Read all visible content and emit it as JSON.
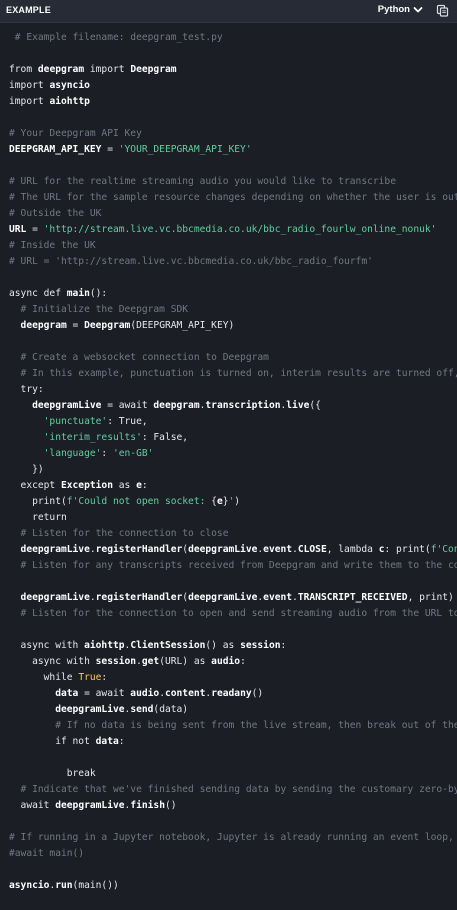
{
  "header": {
    "label": "EXAMPLE",
    "language": "Python"
  },
  "code": {
    "lines": [
      [
        {
          "t": " # Example filename: deepgram_test.py",
          "k": "c"
        }
      ],
      [],
      [
        {
          "t": "from ",
          "k": "n"
        },
        {
          "t": "deepgram",
          "k": "b"
        },
        {
          "t": " import ",
          "k": "n"
        },
        {
          "t": "Deepgram",
          "k": "b"
        }
      ],
      [
        {
          "t": "import ",
          "k": "n"
        },
        {
          "t": "asyncio",
          "k": "b"
        }
      ],
      [
        {
          "t": "import ",
          "k": "n"
        },
        {
          "t": "aiohttp",
          "k": "b"
        }
      ],
      [],
      [
        {
          "t": "# Your Deepgram API Key",
          "k": "c"
        }
      ],
      [
        {
          "t": "DEEPGRAM_API_KEY",
          "k": "b"
        },
        {
          "t": " = ",
          "k": "n"
        },
        {
          "t": "'YOUR_DEEPGRAM_API_KEY'",
          "k": "s"
        }
      ],
      [],
      [
        {
          "t": "# URL for the realtime streaming audio you would like to transcribe",
          "k": "c"
        }
      ],
      [
        {
          "t": "# The URL for the sample resource changes depending on whether the user is outsi",
          "k": "c"
        }
      ],
      [
        {
          "t": "# Outside the UK",
          "k": "c"
        }
      ],
      [
        {
          "t": "URL",
          "k": "b"
        },
        {
          "t": " = ",
          "k": "n"
        },
        {
          "t": "'http://stream.live.vc.bbcmedia.co.uk/bbc_radio_fourlw_online_nonuk'",
          "k": "s"
        }
      ],
      [
        {
          "t": "# Inside the UK",
          "k": "c"
        }
      ],
      [
        {
          "t": "# URL = 'http://stream.live.vc.bbcmedia.co.uk/bbc_radio_fourfm'",
          "k": "c"
        }
      ],
      [],
      [
        {
          "t": "async def ",
          "k": "n"
        },
        {
          "t": "main",
          "k": "b"
        },
        {
          "t": "():",
          "k": "n"
        }
      ],
      [
        {
          "t": "  # Initialize the Deepgram SDK",
          "k": "c"
        }
      ],
      [
        {
          "t": "  deepgram",
          "k": "b"
        },
        {
          "t": " = ",
          "k": "n"
        },
        {
          "t": "Deepgram",
          "k": "b"
        },
        {
          "t": "(DEEPGRAM_API_KEY)",
          "k": "n"
        }
      ],
      [],
      [
        {
          "t": "  # Create a websocket connection to Deepgram",
          "k": "c"
        }
      ],
      [
        {
          "t": "  # In this example, punctuation is turned on, interim results are turned off, a",
          "k": "c"
        }
      ],
      [
        {
          "t": "  try:",
          "k": "n"
        }
      ],
      [
        {
          "t": "    deepgramLive",
          "k": "b"
        },
        {
          "t": " = await ",
          "k": "n"
        },
        {
          "t": "deepgram",
          "k": "b"
        },
        {
          "t": ".",
          "k": "n"
        },
        {
          "t": "transcription",
          "k": "b"
        },
        {
          "t": ".",
          "k": "n"
        },
        {
          "t": "live",
          "k": "b"
        },
        {
          "t": "({",
          "k": "n"
        }
      ],
      [
        {
          "t": "      ",
          "k": "n"
        },
        {
          "t": "'punctuate'",
          "k": "s"
        },
        {
          "t": ": True,",
          "k": "n"
        }
      ],
      [
        {
          "t": "      ",
          "k": "n"
        },
        {
          "t": "'interim_results'",
          "k": "s"
        },
        {
          "t": ": False,",
          "k": "n"
        }
      ],
      [
        {
          "t": "      ",
          "k": "n"
        },
        {
          "t": "'language'",
          "k": "s"
        },
        {
          "t": ": ",
          "k": "n"
        },
        {
          "t": "'en-GB'",
          "k": "s"
        }
      ],
      [
        {
          "t": "    })",
          "k": "n"
        }
      ],
      [
        {
          "t": "  except ",
          "k": "n"
        },
        {
          "t": "Exception",
          "k": "b"
        },
        {
          "t": " as ",
          "k": "n"
        },
        {
          "t": "e",
          "k": "b"
        },
        {
          "t": ":",
          "k": "n"
        }
      ],
      [
        {
          "t": "    print(",
          "k": "n"
        },
        {
          "t": "f'Could not open socket: ",
          "k": "s"
        },
        {
          "t": "{",
          "k": "n"
        },
        {
          "t": "e",
          "k": "b"
        },
        {
          "t": "}",
          "k": "n"
        },
        {
          "t": "'",
          "k": "s"
        },
        {
          "t": ")",
          "k": "n"
        }
      ],
      [
        {
          "t": "    return",
          "k": "n"
        }
      ],
      [],
      [
        {
          "t": "  # Listen for the connection to close",
          "k": "c"
        }
      ],
      [
        {
          "t": "  deepgramLive",
          "k": "b"
        },
        {
          "t": ".",
          "k": "n"
        },
        {
          "t": "registerHandler",
          "k": "b"
        },
        {
          "t": "(",
          "k": "n"
        },
        {
          "t": "deepgramLive",
          "k": "b"
        },
        {
          "t": ".",
          "k": "n"
        },
        {
          "t": "event",
          "k": "b"
        },
        {
          "t": ".",
          "k": "n"
        },
        {
          "t": "CLOSE",
          "k": "b"
        },
        {
          "t": ", lambda ",
          "k": "n"
        },
        {
          "t": "c",
          "k": "b"
        },
        {
          "t": ": print(",
          "k": "n"
        },
        {
          "t": "f'Conne",
          "k": "s"
        }
      ],
      [],
      [
        {
          "t": "  # Listen for any transcripts received from Deepgram and write them to the cons",
          "k": "c"
        }
      ],
      [
        {
          "t": "  deepgramLive",
          "k": "b"
        },
        {
          "t": ".",
          "k": "n"
        },
        {
          "t": "registerHandler",
          "k": "b"
        },
        {
          "t": "(",
          "k": "n"
        },
        {
          "t": "deepgramLive",
          "k": "b"
        },
        {
          "t": ".",
          "k": "n"
        },
        {
          "t": "event",
          "k": "b"
        },
        {
          "t": ".",
          "k": "n"
        },
        {
          "t": "TRANSCRIPT_RECEIVED",
          "k": "b"
        },
        {
          "t": ", print)",
          "k": "n"
        }
      ],
      [],
      [
        {
          "t": "  # Listen for the connection to open and send streaming audio from the URL to D",
          "k": "c"
        }
      ],
      [
        {
          "t": "  async with ",
          "k": "n"
        },
        {
          "t": "aiohttp",
          "k": "b"
        },
        {
          "t": ".",
          "k": "n"
        },
        {
          "t": "ClientSession",
          "k": "b"
        },
        {
          "t": "() as ",
          "k": "n"
        },
        {
          "t": "session",
          "k": "b"
        },
        {
          "t": ":",
          "k": "n"
        }
      ],
      [
        {
          "t": "    async with ",
          "k": "n"
        },
        {
          "t": "session",
          "k": "b"
        },
        {
          "t": ".",
          "k": "n"
        },
        {
          "t": "get",
          "k": "b"
        },
        {
          "t": "(URL) as ",
          "k": "n"
        },
        {
          "t": "audio",
          "k": "b"
        },
        {
          "t": ":",
          "k": "n"
        }
      ],
      [
        {
          "t": "      while ",
          "k": "n"
        },
        {
          "t": "True",
          "k": "y"
        },
        {
          "t": ":",
          "k": "n"
        }
      ],
      [
        {
          "t": "        data",
          "k": "b"
        },
        {
          "t": " = await ",
          "k": "n"
        },
        {
          "t": "audio",
          "k": "b"
        },
        {
          "t": ".",
          "k": "n"
        },
        {
          "t": "content",
          "k": "b"
        },
        {
          "t": ".",
          "k": "n"
        },
        {
          "t": "readany",
          "k": "b"
        },
        {
          "t": "()",
          "k": "n"
        }
      ],
      [
        {
          "t": "        deepgramLive",
          "k": "b"
        },
        {
          "t": ".",
          "k": "n"
        },
        {
          "t": "send",
          "k": "b"
        },
        {
          "t": "(data)",
          "k": "n"
        }
      ],
      [],
      [
        {
          "t": "        # If no data is being sent from the live stream, then break out of the l",
          "k": "c"
        }
      ],
      [
        {
          "t": "        if not ",
          "k": "n"
        },
        {
          "t": "data",
          "k": "b"
        },
        {
          "t": ":",
          "k": "n"
        }
      ],
      [
        {
          "t": "          break",
          "k": "n"
        }
      ],
      [],
      [
        {
          "t": "  # Indicate that we've finished sending data by sending the customary zero-byte",
          "k": "c"
        }
      ],
      [
        {
          "t": "  await ",
          "k": "n"
        },
        {
          "t": "deepgramLive",
          "k": "b"
        },
        {
          "t": ".",
          "k": "n"
        },
        {
          "t": "finish",
          "k": "b"
        },
        {
          "t": "()",
          "k": "n"
        }
      ],
      [],
      [
        {
          "t": "# If running in a Jupyter notebook, Jupyter is already running an event loop, so",
          "k": "c"
        }
      ],
      [
        {
          "t": "#await main()",
          "k": "c"
        }
      ],
      [
        {
          "t": "asyncio",
          "k": "b"
        },
        {
          "t": ".",
          "k": "n"
        },
        {
          "t": "run",
          "k": "b"
        },
        {
          "t": "(main())",
          "k": "n"
        }
      ]
    ],
    "tops": [
      9,
      41,
      57,
      73,
      105,
      121,
      153,
      169,
      185,
      201,
      217,
      233,
      265,
      281,
      297,
      329,
      345,
      361,
      377,
      393,
      409,
      425,
      441,
      457,
      473,
      489,
      505,
      521,
      537,
      569,
      585,
      617,
      633,
      649,
      665,
      681,
      697,
      713,
      745,
      761,
      777,
      809,
      825,
      857,
      873,
      889
    ]
  }
}
